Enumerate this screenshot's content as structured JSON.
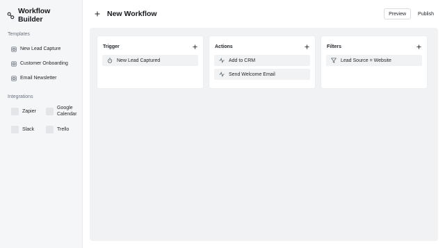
{
  "app": {
    "title": "Workflow Builder"
  },
  "sidebar": {
    "templates_label": "Templates",
    "templates": [
      {
        "label": "New Lead Capture",
        "icon": "template-icon"
      },
      {
        "label": "Customer Onboarding",
        "icon": "template-icon"
      },
      {
        "label": "Email Newsletter",
        "icon": "template-icon"
      }
    ],
    "integrations_label": "Integrations",
    "integrations": [
      {
        "label": "Zapier"
      },
      {
        "label": "Google Calendar"
      },
      {
        "label": "Slack"
      },
      {
        "label": "Trello"
      }
    ]
  },
  "header": {
    "title": "New Workflow",
    "preview_label": "Preview",
    "publish_label": "Publish"
  },
  "panels": [
    {
      "title": "Trigger",
      "items": [
        {
          "label": "New Lead Captured",
          "icon": "timer-icon"
        }
      ]
    },
    {
      "title": "Actions",
      "items": [
        {
          "label": "Add to CRM",
          "icon": "activity-icon"
        },
        {
          "label": "Send Welcome Email",
          "icon": "activity-icon"
        }
      ]
    },
    {
      "title": "Filters",
      "items": [
        {
          "label": "Lead Source = Website",
          "icon": "filter-icon"
        }
      ]
    }
  ],
  "colors": {
    "sidebar_bg": "#f5f6f7",
    "canvas_bg": "#f1f2f3",
    "text": "#1f2328"
  }
}
